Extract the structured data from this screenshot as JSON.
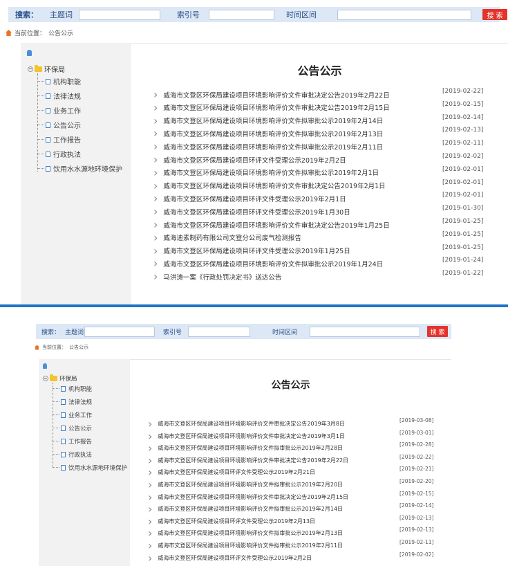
{
  "search": {
    "label": "搜索：",
    "field1_label": "主题词",
    "field2_label": "索引号",
    "field3_label": "时间区间",
    "button_label": "搜 索"
  },
  "breadcrumb": {
    "prefix": "当前位置：",
    "current": "公告公示"
  },
  "tree": {
    "root": "环保局",
    "items": [
      "机构职能",
      "法律法规",
      "业务工作",
      "公告公示",
      "工作报告",
      "行政执法",
      "饮用水水源地环境保护"
    ]
  },
  "page_title": "公告公示",
  "list1": [
    {
      "title": "威海市文登区环保局建设项目环境影响评价文件审批决定公告2019年2月22日",
      "date": "[2019-02-22]"
    },
    {
      "title": "威海市文登区环保局建设项目环境影响评价文件审批决定公告2019年2月15日",
      "date": "[2019-02-15]"
    },
    {
      "title": "威海市文登区环保局建设项目环境影响评价文件拟审批公示2019年2月14日",
      "date": "[2019-02-14]"
    },
    {
      "title": "威海市文登区环保局建设项目环境影响评价文件拟审批公示2019年2月13日",
      "date": "[2019-02-13]"
    },
    {
      "title": "威海市文登区环保局建设项目环境影响评价文件拟审批公示2019年2月11日",
      "date": "[2019-02-11]"
    },
    {
      "title": "威海市文登区环保局建设项目环评文件受理公示2019年2月2日",
      "date": "[2019-02-02]"
    },
    {
      "title": "威海市文登区环保局建设项目环境影响评价文件拟审批公示2019年2月1日",
      "date": "[2019-02-01]"
    },
    {
      "title": "威海市文登区环保局建设项目环境影响评价文件审批决定公告2019年2月1日",
      "date": "[2019-02-01]"
    },
    {
      "title": "威海市文登区环保局建设项目环评文件受理公示2019年2月1日",
      "date": "[2019-02-01]"
    },
    {
      "title": "威海市文登区环保局建设项目环评文件受理公示2019年1月30日",
      "date": "[2019-01-30]"
    },
    {
      "title": "威海市文登区环保局建设项目环境影响评价文件审批决定公告2019年1月25日",
      "date": "[2019-01-25]"
    },
    {
      "title": "威海迪素制药有限公司文登分公司废气检测报告",
      "date": "[2019-01-25]"
    },
    {
      "title": "威海市文登区环保局建设项目环评文件受理公示2019年1月25日",
      "date": "[2019-01-25]"
    },
    {
      "title": "威海市文登区环保局建设项目环境影响评价文件拟审批公示2019年1月24日",
      "date": "[2019-01-24]"
    },
    {
      "title": "马洪涛一案《行政处罚决定书》送达公告",
      "date": "[2019-01-22]"
    }
  ],
  "list2": [
    {
      "title": "威海市文登区环保局建设项目环境影响评价文件审批决定公告2019年3月8日",
      "date": "[2019-03-08]"
    },
    {
      "title": "威海市文登区环保局建设项目环境影响评价文件审批决定公告2019年3月1日",
      "date": "[2019-03-01]"
    },
    {
      "title": "威海市文登区环保局建设项目环境影响评价文件拟审批公示2019年2月28日",
      "date": "[2019-02-28]"
    },
    {
      "title": "威海市文登区环保局建设项目环境影响评价文件审批决定公告2019年2月22日",
      "date": "[2019-02-22]"
    },
    {
      "title": "威海市文登区环保局建设项目环评文件受理公示2019年2月21日",
      "date": "[2019-02-21]"
    },
    {
      "title": "威海市文登区环保局建设项目环境影响评价文件拟审批公示2019年2月20日",
      "date": "[2019-02-20]"
    },
    {
      "title": "威海市文登区环保局建设项目环境影响评价文件审批决定公告2019年2月15日",
      "date": "[2019-02-15]"
    },
    {
      "title": "威海市文登区环保局建设项目环境影响评价文件拟审批公示2019年2月14日",
      "date": "[2019-02-14]"
    },
    {
      "title": "威海市文登区环保局建设项目环评文件受理公示2019年2月13日",
      "date": "[2019-02-13]"
    },
    {
      "title": "威海市文登区环保局建设项目环境影响评价文件拟审批公示2019年2月13日",
      "date": "[2019-02-13]"
    },
    {
      "title": "威海市文登区环保局建设项目环境影响评价文件拟审批公示2019年2月11日",
      "date": "[2019-02-11]"
    },
    {
      "title": "威海市文登区环保局建设项目环评文件受理公示2019年2月2日",
      "date": "[2019-02-02]"
    }
  ]
}
